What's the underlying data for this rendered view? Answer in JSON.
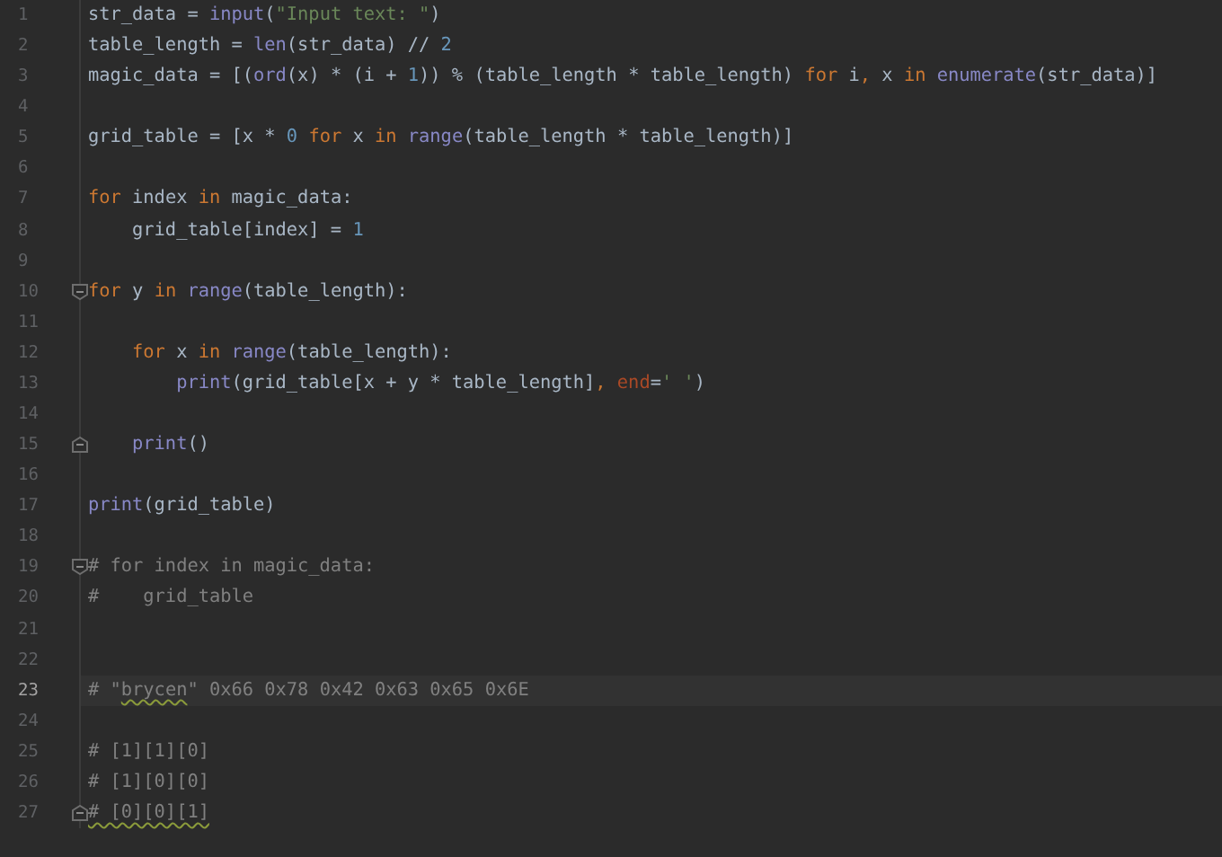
{
  "editor": {
    "lines": [
      {
        "number": "1",
        "tokens": [
          {
            "kind": "plain",
            "text": "str_data = "
          },
          {
            "kind": "builtin",
            "text": "input"
          },
          {
            "kind": "plain",
            "text": "("
          },
          {
            "kind": "string",
            "text": "\"Input text: \""
          },
          {
            "kind": "plain",
            "text": ")"
          }
        ]
      },
      {
        "number": "2",
        "tokens": [
          {
            "kind": "plain",
            "text": "table_length = "
          },
          {
            "kind": "builtin",
            "text": "len"
          },
          {
            "kind": "plain",
            "text": "(str_data) // "
          },
          {
            "kind": "number",
            "text": "2"
          }
        ]
      },
      {
        "number": "3",
        "tokens": [
          {
            "kind": "plain",
            "text": "magic_data = [("
          },
          {
            "kind": "builtin",
            "text": "ord"
          },
          {
            "kind": "plain",
            "text": "(x) * (i + "
          },
          {
            "kind": "number",
            "text": "1"
          },
          {
            "kind": "plain",
            "text": ")) % (table_length * table_length) "
          },
          {
            "kind": "keyword",
            "text": "for"
          },
          {
            "kind": "plain",
            "text": " i"
          },
          {
            "kind": "punct",
            "text": ","
          },
          {
            "kind": "plain",
            "text": " x "
          },
          {
            "kind": "keyword",
            "text": "in "
          },
          {
            "kind": "builtin",
            "text": "enumerate"
          },
          {
            "kind": "plain",
            "text": "(str_data)]"
          }
        ]
      },
      {
        "number": "4"
      },
      {
        "number": "5",
        "tokens": [
          {
            "kind": "plain",
            "text": "grid_table = [x * "
          },
          {
            "kind": "number",
            "text": "0 "
          },
          {
            "kind": "keyword",
            "text": "for"
          },
          {
            "kind": "plain",
            "text": " x "
          },
          {
            "kind": "keyword",
            "text": "in "
          },
          {
            "kind": "builtin",
            "text": "range"
          },
          {
            "kind": "plain",
            "text": "(table_length * table_length)]"
          }
        ]
      },
      {
        "number": "6"
      },
      {
        "number": "7",
        "tokens": [
          {
            "kind": "keyword",
            "text": "for"
          },
          {
            "kind": "plain",
            "text": " index "
          },
          {
            "kind": "keyword",
            "text": "in"
          },
          {
            "kind": "plain",
            "text": " magic_data:"
          }
        ]
      },
      {
        "number": "8",
        "tokens": [
          {
            "kind": "plain",
            "text": "    grid_table[index] = "
          },
          {
            "kind": "number",
            "text": "1"
          }
        ]
      },
      {
        "number": "9"
      },
      {
        "number": "10",
        "fold_start": true,
        "tokens": [
          {
            "kind": "keyword",
            "text": "for"
          },
          {
            "kind": "plain",
            "text": " y "
          },
          {
            "kind": "keyword",
            "text": "in "
          },
          {
            "kind": "builtin",
            "text": "range"
          },
          {
            "kind": "plain",
            "text": "(table_length):"
          }
        ]
      },
      {
        "number": "11"
      },
      {
        "number": "12",
        "tokens": [
          {
            "kind": "keyword",
            "text": "    for"
          },
          {
            "kind": "plain",
            "text": " x "
          },
          {
            "kind": "keyword",
            "text": "in "
          },
          {
            "kind": "builtin",
            "text": "range"
          },
          {
            "kind": "plain",
            "text": "(table_length):"
          }
        ]
      },
      {
        "number": "13",
        "tokens": [
          {
            "kind": "builtin",
            "text": "        print"
          },
          {
            "kind": "plain",
            "text": "(grid_table[x + y * table_length]"
          },
          {
            "kind": "punct",
            "text": ", "
          },
          {
            "kind": "param",
            "text": "end"
          },
          {
            "kind": "plain",
            "text": "="
          },
          {
            "kind": "string",
            "text": "' '"
          },
          {
            "kind": "plain",
            "text": ")"
          }
        ]
      },
      {
        "number": "14"
      },
      {
        "number": "15",
        "fold_end": true,
        "tokens": [
          {
            "kind": "builtin",
            "text": "    print"
          },
          {
            "kind": "plain",
            "text": "()"
          }
        ]
      },
      {
        "number": "16"
      },
      {
        "number": "17",
        "tokens": [
          {
            "kind": "builtin",
            "text": "print"
          },
          {
            "kind": "plain",
            "text": "(grid_table)"
          }
        ]
      },
      {
        "number": "18"
      },
      {
        "number": "19",
        "fold_start": true,
        "tokens": [
          {
            "kind": "comment",
            "text": "# for index in magic_data:"
          }
        ]
      },
      {
        "number": "20",
        "tokens": [
          {
            "kind": "comment",
            "text": "#    grid_table"
          }
        ]
      },
      {
        "number": "21"
      },
      {
        "number": "22"
      },
      {
        "number": "23",
        "current": true,
        "tokens": [
          {
            "kind": "comment",
            "text": "# \""
          },
          {
            "kind": "comment",
            "text": "brycen",
            "underlined": true
          },
          {
            "kind": "comment",
            "text": "\" 0x66 0x78 0x42 0x63 0x65 0x6E"
          }
        ]
      },
      {
        "number": "24"
      },
      {
        "number": "25",
        "tokens": [
          {
            "kind": "comment",
            "text": "# [1][1][0]"
          }
        ]
      },
      {
        "number": "26",
        "tokens": [
          {
            "kind": "comment",
            "text": "# [1][0][0]"
          }
        ]
      },
      {
        "number": "27",
        "fold_end": true,
        "tokens": [
          {
            "kind": "comment",
            "text": "# [0][0][1]",
            "underlined": true
          }
        ]
      }
    ]
  }
}
